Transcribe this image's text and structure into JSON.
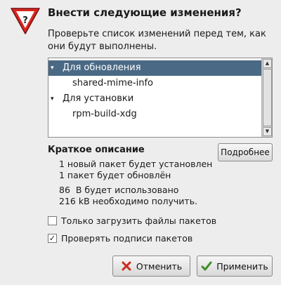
{
  "dialog": {
    "title": "Внести следующие изменения?",
    "subtitle": "Проверьте список изменений перед тем, как они будут выполнены."
  },
  "tree": {
    "rows": [
      {
        "label": "Для обновления",
        "expander": "▾",
        "selected": true
      },
      {
        "label": "shared-mime-info"
      },
      {
        "label": "Для установки",
        "expander": "▾"
      },
      {
        "label": "rpm-build-xdg"
      }
    ]
  },
  "summary": {
    "title": "Краткое описание",
    "details_label": "Подробнее",
    "lines": [
      "1 новый пакет будет установлен",
      "1 пакет будет обновлён",
      "86  B будет использовано",
      "216 kB необходимо получить."
    ]
  },
  "options": {
    "download_only": {
      "label": "Только загрузить файлы пакетов",
      "checked": false
    },
    "verify_signatures": {
      "label": "Проверять подписи пакетов",
      "checked": true
    }
  },
  "buttons": {
    "cancel": {
      "label": "Отменить",
      "icon": "cancel-x-icon"
    },
    "apply": {
      "label": "Применить",
      "icon": "check-icon"
    }
  },
  "colors": {
    "selection": "#4a6985",
    "warning_red": "#d8261f",
    "cancel_icon": "#cc2a1e",
    "apply_icon": "#3d8b2b"
  }
}
